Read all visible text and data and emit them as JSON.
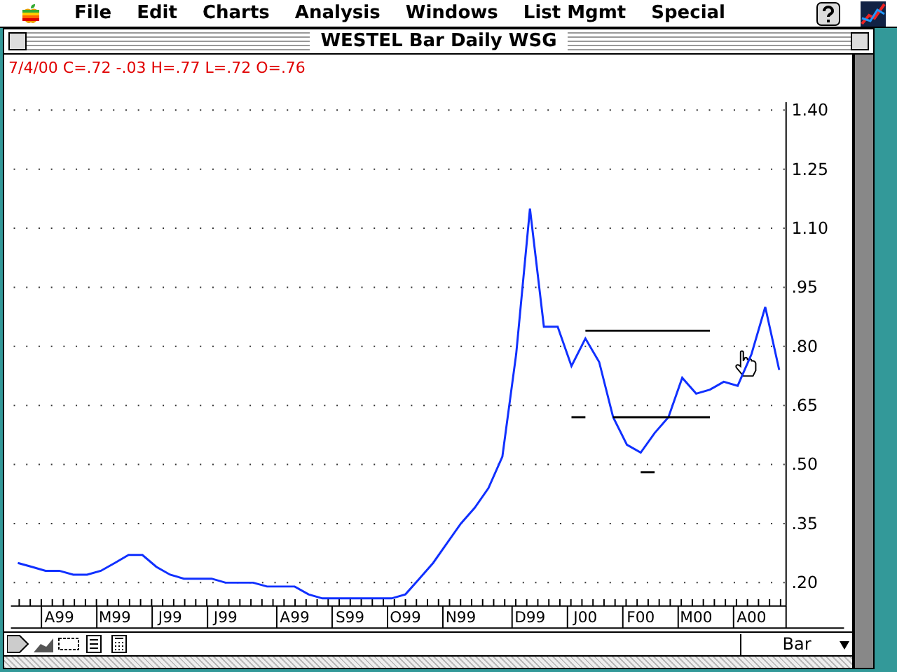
{
  "menu_bar": {
    "items": [
      "File",
      "Edit",
      "Charts",
      "Analysis",
      "Windows",
      "List Mgmt",
      "Special"
    ]
  },
  "window": {
    "title": "WESTEL Bar Daily WSG"
  },
  "quote_line": "7/4/00 C=.72 -.03 H=.77 L=.72 O=.76",
  "chart": {
    "chart_data": {
      "type": "line",
      "grid": true,
      "ylim": [
        0.14,
        1.42
      ],
      "categories": [
        null,
        null,
        null,
        "A99",
        null,
        null,
        null,
        "M99",
        null,
        null,
        null,
        "J99",
        null,
        null,
        null,
        "J99",
        null,
        null,
        null,
        null,
        "A99",
        null,
        null,
        null,
        "S99",
        null,
        null,
        null,
        "O99",
        null,
        null,
        null,
        "N99",
        null,
        null,
        null,
        null,
        "D99",
        null,
        null,
        null,
        "J00",
        null,
        null,
        null,
        "F00",
        null,
        null,
        null,
        "M00",
        null,
        null,
        null,
        "A00",
        null,
        null
      ],
      "series": [
        {
          "color": "#1030ff",
          "values": [
            0.25,
            0.24,
            0.23,
            0.23,
            0.22,
            0.22,
            0.23,
            0.25,
            0.27,
            0.27,
            0.24,
            0.22,
            0.21,
            0.21,
            0.21,
            0.2,
            0.2,
            0.2,
            0.19,
            0.19,
            0.19,
            0.17,
            0.16,
            0.16,
            0.16,
            0.16,
            0.16,
            0.16,
            0.17,
            0.21,
            0.25,
            0.3,
            0.35,
            0.39,
            0.44,
            0.52,
            0.78,
            1.15,
            0.85,
            0.85,
            0.75,
            0.82,
            0.76,
            0.62,
            0.55,
            0.53,
            0.58,
            0.62,
            0.72,
            0.68,
            0.69,
            0.71,
            0.7,
            0.78,
            0.9,
            0.74
          ]
        },
        {
          "color": "#000000",
          "values": [
            null,
            null,
            null,
            null,
            null,
            null,
            null,
            null,
            null,
            null,
            null,
            null,
            null,
            null,
            null,
            null,
            null,
            null,
            null,
            null,
            null,
            null,
            null,
            null,
            null,
            null,
            null,
            null,
            null,
            null,
            null,
            null,
            null,
            null,
            null,
            null,
            null,
            null,
            null,
            null,
            null,
            0.84,
            0.84,
            0.84,
            0.84,
            0.84,
            0.84,
            0.84,
            0.84,
            0.84,
            0.84,
            null,
            null,
            null,
            null,
            null
          ]
        },
        {
          "color": "#000000",
          "values": [
            null,
            null,
            null,
            null,
            null,
            null,
            null,
            null,
            null,
            null,
            null,
            null,
            null,
            null,
            null,
            null,
            null,
            null,
            null,
            null,
            null,
            null,
            null,
            null,
            null,
            null,
            null,
            null,
            null,
            null,
            null,
            null,
            null,
            null,
            null,
            null,
            null,
            null,
            null,
            null,
            null,
            null,
            null,
            0.62,
            0.62,
            0.62,
            0.62,
            0.62,
            0.62,
            0.62,
            0.62,
            null,
            null,
            null,
            null,
            null
          ]
        },
        {
          "color": "#000000",
          "values": [
            null,
            null,
            null,
            null,
            null,
            null,
            null,
            null,
            null,
            null,
            null,
            null,
            null,
            null,
            null,
            null,
            null,
            null,
            null,
            null,
            null,
            null,
            null,
            null,
            null,
            null,
            null,
            null,
            null,
            null,
            null,
            null,
            null,
            null,
            null,
            null,
            null,
            null,
            null,
            null,
            0.62,
            0.62,
            null,
            null,
            null,
            null,
            null,
            null,
            null,
            null,
            null,
            null,
            null,
            null,
            null,
            null
          ]
        },
        {
          "color": "#000000",
          "values": [
            null,
            null,
            null,
            null,
            null,
            null,
            null,
            null,
            null,
            null,
            null,
            null,
            null,
            null,
            null,
            null,
            null,
            null,
            null,
            null,
            null,
            null,
            null,
            null,
            null,
            null,
            null,
            null,
            null,
            null,
            null,
            null,
            null,
            null,
            null,
            null,
            null,
            null,
            null,
            null,
            null,
            null,
            null,
            null,
            null,
            0.48,
            0.48,
            null,
            null,
            null,
            null,
            null,
            null,
            null,
            null,
            null
          ]
        }
      ],
      "yticks": [
        {
          "value": 0.2,
          "label": ".20"
        },
        {
          "value": 0.35,
          "label": ".35"
        },
        {
          "value": 0.5,
          "label": ".50"
        },
        {
          "value": 0.65,
          "label": ".65"
        },
        {
          "value": 0.8,
          "label": ".80"
        },
        {
          "value": 0.95,
          "label": ".95"
        },
        {
          "value": 1.1,
          "label": "1.10"
        },
        {
          "value": 1.25,
          "label": "1.25"
        },
        {
          "value": 1.4,
          "label": "1.40"
        }
      ]
    }
  },
  "toolbar": {
    "chart_style": "Bar"
  }
}
